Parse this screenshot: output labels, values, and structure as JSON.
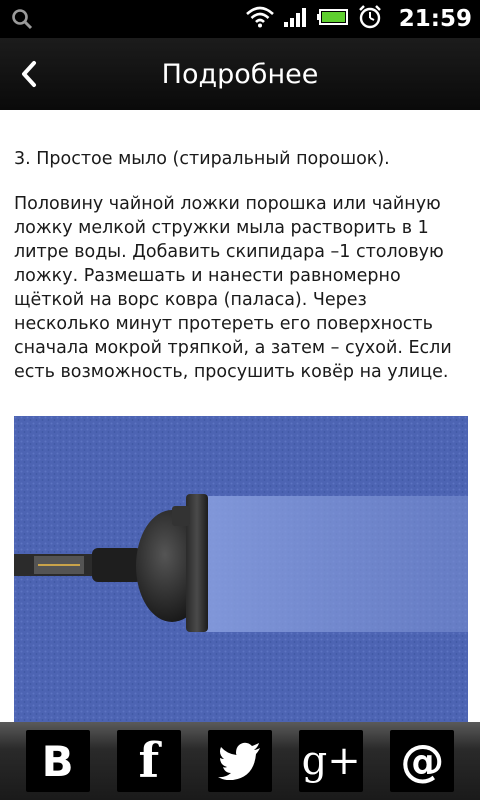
{
  "status_bar": {
    "time": "21:59",
    "icons": [
      "search-icon",
      "wifi-icon",
      "signal-icon",
      "battery-icon",
      "alarm-icon"
    ]
  },
  "app_bar": {
    "title": "Подробнее",
    "back_icon": "chevron-left-icon"
  },
  "article": {
    "heading": "3. Простое мыло (стиральный порошок).",
    "body": "Половину чайной ложки порошка или чайную ложку мелкой стружки мыла растворить в 1 литре воды. Добавить скипидара –1 столовую ложку. Размешать и нанести равномерно щёткой на ворс ковра (паласа). Через несколько минут протереть его поверхность сначала мокрой тряпкой, а затем – сухой. Если есть возможность, просушить ковёр на улице.",
    "image": "vacuum-cleaner-on-blue-carpet-photo"
  },
  "share_bar": {
    "buttons": [
      {
        "label": "B",
        "icon": "vk-icon"
      },
      {
        "label": "f",
        "icon": "facebook-icon"
      },
      {
        "label": "",
        "icon": "twitter-icon"
      },
      {
        "label": "g+",
        "icon": "google-plus-icon"
      },
      {
        "label": "@",
        "icon": "email-icon"
      }
    ]
  },
  "colors": {
    "status_bar_bg": "#000000",
    "app_bar_bg": "#111111",
    "carpet_blue": "#4a63b0",
    "share_bar_bg": "#222222"
  }
}
